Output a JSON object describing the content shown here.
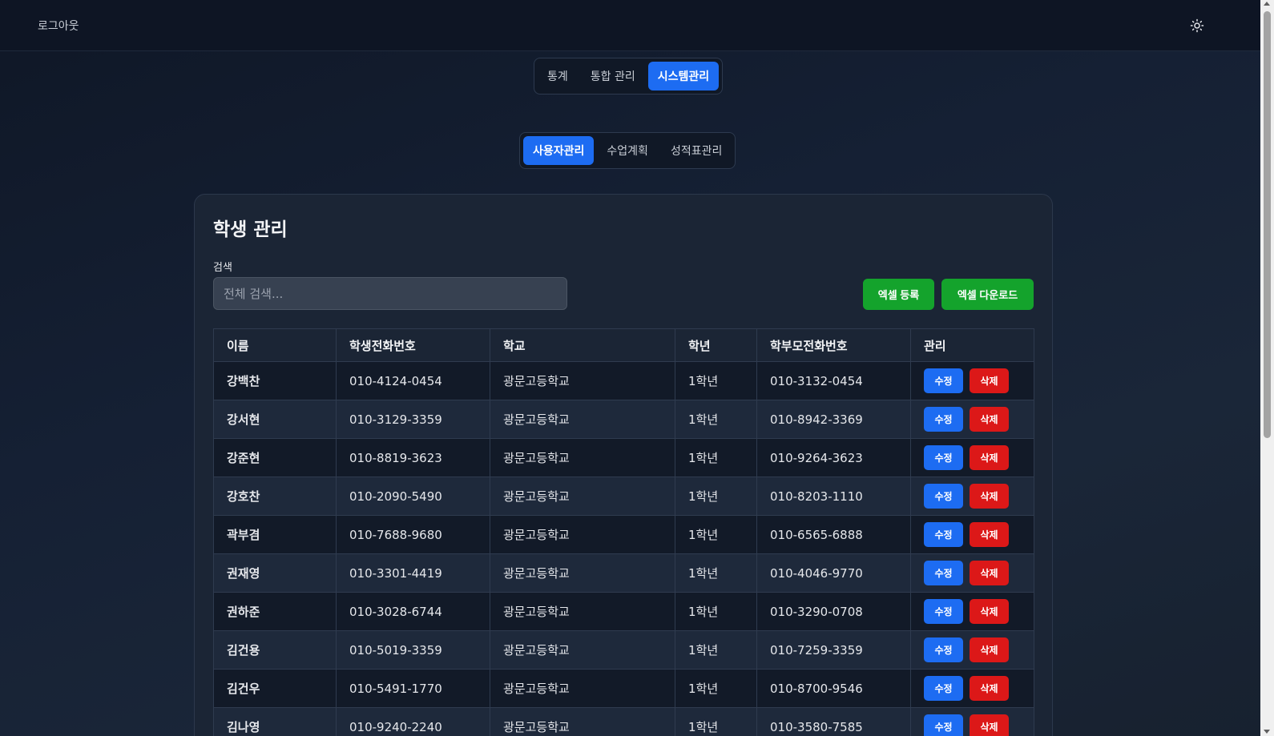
{
  "header": {
    "logout_label": "로그아웃",
    "theme_icon": "sun-icon"
  },
  "main_tabs": [
    {
      "label": "통계",
      "active": false
    },
    {
      "label": "통합 관리",
      "active": false
    },
    {
      "label": "시스템관리",
      "active": true
    }
  ],
  "sub_tabs": [
    {
      "label": "사용자관리",
      "active": true
    },
    {
      "label": "수업계획",
      "active": false
    },
    {
      "label": "성적표관리",
      "active": false
    }
  ],
  "card": {
    "title": "학생 관리",
    "search_label": "검색",
    "search_placeholder": "전체 검색...",
    "search_value": "",
    "excel_upload_label": "엑셀 등록",
    "excel_download_label": "엑셀 다운로드"
  },
  "table": {
    "columns": [
      "이름",
      "학생전화번호",
      "학교",
      "학년",
      "학부모전화번호",
      "관리"
    ],
    "edit_label": "수정",
    "delete_label": "삭제",
    "rows": [
      {
        "name": "강백찬",
        "student_phone": "010-4124-0454",
        "school": "광문고등학교",
        "grade": "1학년",
        "parent_phone": "010-3132-0454"
      },
      {
        "name": "강서현",
        "student_phone": "010-3129-3359",
        "school": "광문고등학교",
        "grade": "1학년",
        "parent_phone": "010-8942-3369"
      },
      {
        "name": "강준현",
        "student_phone": "010-8819-3623",
        "school": "광문고등학교",
        "grade": "1학년",
        "parent_phone": "010-9264-3623"
      },
      {
        "name": "강호찬",
        "student_phone": "010-2090-5490",
        "school": "광문고등학교",
        "grade": "1학년",
        "parent_phone": "010-8203-1110"
      },
      {
        "name": "곽부겸",
        "student_phone": "010-7688-9680",
        "school": "광문고등학교",
        "grade": "1학년",
        "parent_phone": "010-6565-6888"
      },
      {
        "name": "권재영",
        "student_phone": "010-3301-4419",
        "school": "광문고등학교",
        "grade": "1학년",
        "parent_phone": "010-4046-9770"
      },
      {
        "name": "권하준",
        "student_phone": "010-3028-6744",
        "school": "광문고등학교",
        "grade": "1학년",
        "parent_phone": "010-3290-0708"
      },
      {
        "name": "김건용",
        "student_phone": "010-5019-3359",
        "school": "광문고등학교",
        "grade": "1학년",
        "parent_phone": "010-7259-3359"
      },
      {
        "name": "김건우",
        "student_phone": "010-5491-1770",
        "school": "광문고등학교",
        "grade": "1학년",
        "parent_phone": "010-8700-9546"
      },
      {
        "name": "김나영",
        "student_phone": "010-9240-2240",
        "school": "광문고등학교",
        "grade": "1학년",
        "parent_phone": "010-3580-7585"
      }
    ]
  }
}
